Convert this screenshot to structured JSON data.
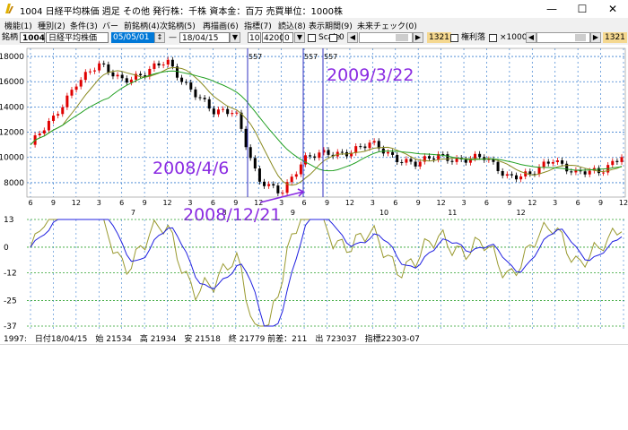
{
  "window": {
    "title": "1004 日経平均株価 週足 その他 発行株：千株 資本金：百万 売買単位：1000株",
    "min_icon": "minimize-icon",
    "max_icon": "maximize-icon",
    "close_icon": "close-icon"
  },
  "menu": [
    {
      "label": "機能(1)"
    },
    {
      "label": "種別(2)"
    },
    {
      "label": "条件(3)"
    },
    {
      "label": "バー"
    },
    {
      "label": "前銘柄(4)"
    },
    {
      "label": "次銘柄(5)"
    },
    {
      "label": "再描画(6)"
    },
    {
      "label": "指標(7)"
    },
    {
      "label": "読込(8)"
    },
    {
      "label": "表示期間(9)"
    },
    {
      "label": "未来チェック(0)"
    }
  ],
  "toolbar": {
    "code_label": "銘柄",
    "code_value": "1004",
    "name_value": "日経平均株価",
    "date_from": "05/05/01",
    "dash": "—",
    "date_to": "18/04/15",
    "num1": "10",
    "num2": "4200",
    "num3": "0",
    "scale_label": "Scale",
    "scale_value": "0",
    "count_badge": "1321",
    "rights_label": "権利落",
    "zoom_label": "×1000",
    "count_badge2": "1321"
  },
  "chart": {
    "price_ticks": [
      "18000",
      "16000",
      "14000",
      "12000",
      "10000",
      "8000"
    ],
    "osc_ticks": [
      "13",
      "0",
      "-12",
      "-25",
      "-37"
    ],
    "x_minor": [
      "6",
      "9",
      "12",
      "3",
      "6",
      "9",
      "12",
      "3",
      "6",
      "9",
      "12",
      "3",
      "6",
      "9",
      "12",
      "3",
      "6",
      "9",
      "12",
      "3",
      "6",
      "9",
      "12",
      "3",
      "6",
      "9",
      "12"
    ],
    "year_labels": [
      "7",
      "8",
      "9",
      "10",
      "11",
      "12"
    ],
    "marker_labels": [
      "557",
      "557",
      "557"
    ],
    "annotations": [
      "2008/4/6",
      "2009/3/22",
      "2008/12/21"
    ],
    "colors": {
      "candle_up": "#e00000",
      "candle_down": "#000000",
      "ma_short": "#8a8a20",
      "ma_long": "#22a022",
      "vline": "#3030c0",
      "annot": "#8a2be2",
      "osc_blue": "#2020e0",
      "osc_olive": "#9a9a30"
    }
  },
  "chart_data": {
    "type": "line",
    "title": "",
    "xlabel": "",
    "ylabel": "",
    "x": [
      "2006-06",
      "2006-09",
      "2006-12",
      "2007-03",
      "2007-06",
      "2007-09",
      "2007-12",
      "2008-03",
      "2008-06",
      "2008-09",
      "2008-12",
      "2009-03",
      "2009-06",
      "2009-09",
      "2009-12",
      "2010-03",
      "2010-06",
      "2010-09",
      "2010-12",
      "2011-03",
      "2011-06",
      "2011-09",
      "2011-12",
      "2012-03",
      "2012-06",
      "2012-09",
      "2012-12"
    ],
    "series": [
      {
        "values": [
          11000,
          13000,
          16000,
          17200,
          16300,
          16500,
          17700,
          15500,
          13500,
          13900,
          8000,
          7300,
          9800,
          10300,
          10500,
          11000,
          10100,
          9400,
          10200,
          9800,
          9900,
          8600,
          8500,
          10000,
          8700,
          8800,
          10300
        ]
      }
    ],
    "ylim": [
      7000,
      18500
    ],
    "oscillator_ylim": [
      -37,
      13
    ]
  },
  "status": {
    "text": "1997:　日付18/04/15　始 21534　高 21934　安 21518　終 21779 前差：211　出 723037　指標22303-07"
  }
}
